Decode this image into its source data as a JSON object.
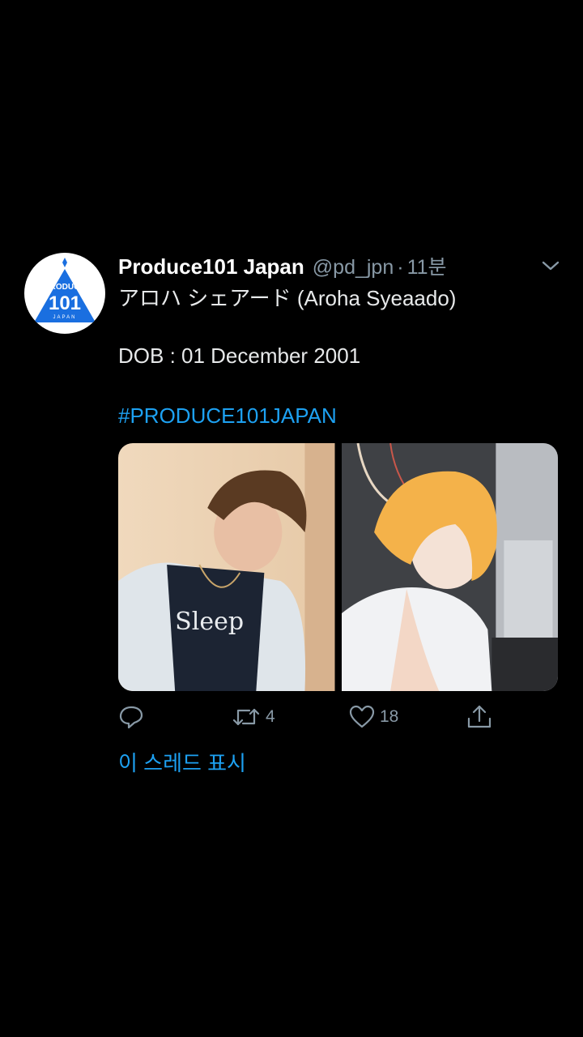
{
  "tweet": {
    "author_name": "Produce101 Japan",
    "handle": "@pd_jpn",
    "separator": "·",
    "time": "11분",
    "avatar_logo": {
      "top": "PRODUCE",
      "number": "101",
      "bottom": "JAPAN"
    },
    "line1": "アロハ シェアード (Aroha Syeaado)",
    "line2": "DOB : 01 December 2001",
    "hashtag": "#PRODUCE101JAPAN",
    "shirt_text": "Sleep",
    "actions": {
      "reply_count": "",
      "retweet_count": "4",
      "like_count": "18"
    },
    "show_thread": "이 스레드 표시",
    "colors": {
      "accent": "#1da1f2",
      "muted": "#8899a6",
      "background": "#000000",
      "logo_blue": "#1a6fe0"
    },
    "icons": [
      "chevron-down-icon",
      "reply-icon",
      "retweet-icon",
      "like-icon",
      "share-icon"
    ]
  }
}
